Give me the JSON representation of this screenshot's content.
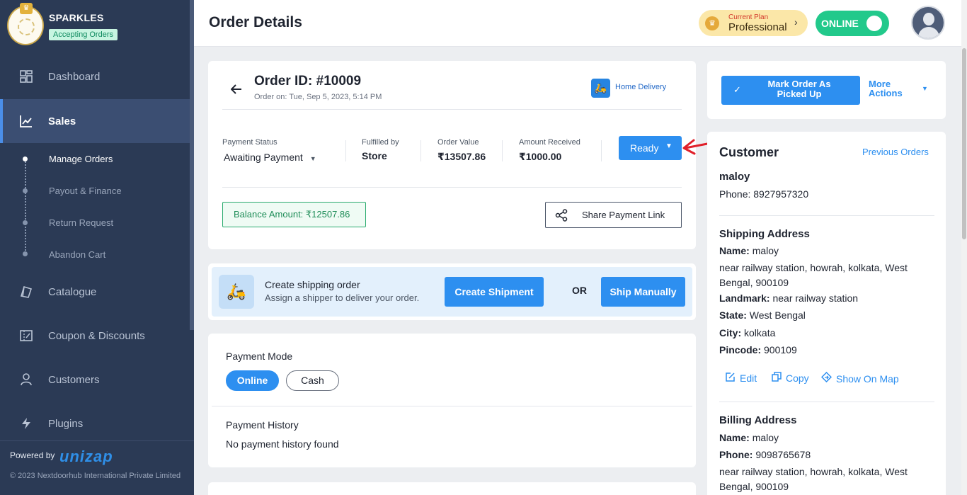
{
  "sidebar": {
    "store_name": "SPARKLES",
    "store_status": "Accepting Orders",
    "nav": [
      {
        "label": "Dashboard",
        "icon": "dashboard-icon"
      },
      {
        "label": "Sales",
        "icon": "chart-line-icon"
      },
      {
        "label": "Catalogue",
        "icon": "catalogue-icon"
      },
      {
        "label": "Coupon & Discounts",
        "icon": "coupon-icon"
      },
      {
        "label": "Customers",
        "icon": "user-icon"
      },
      {
        "label": "Plugins",
        "icon": "lightning-icon"
      }
    ],
    "sales_sub": [
      "Manage Orders",
      "Payout & Finance",
      "Return Request",
      "Abandon Cart"
    ],
    "powered_by": "Powered by",
    "powered_logo": "unizap",
    "copyright": "© 2023 Nextdoorhub International Private Limited"
  },
  "header": {
    "title": "Order Details",
    "plan_caption": "Current Plan",
    "plan_name": "Professional",
    "online_label": "ONLINE"
  },
  "order": {
    "id": "Order ID: #10009",
    "date": "Order on: Tue, Sep 5, 2023, 5:14 PM",
    "delivery_type": "Home Delivery",
    "payment_status_label": "Payment Status",
    "payment_status": "Awaiting Payment",
    "fulfilled_label": "Fulfilled by",
    "fulfilled_by": "Store",
    "value_label": "Order Value",
    "value": "₹13507.86",
    "received_label": "Amount Received",
    "received": "₹1000.00",
    "status_button": "Ready",
    "balance": "Balance Amount: ₹12507.86",
    "share_link": "Share Payment Link"
  },
  "shipping": {
    "title": "Create shipping order",
    "subtitle": "Assign a shipper to deliver your order.",
    "create_button": "Create Shipment",
    "or_text": "OR",
    "manual_button": "Ship Manually"
  },
  "payment": {
    "mode_title": "Payment Mode",
    "modes": [
      "Online",
      "Cash"
    ],
    "selected_mode": "Online",
    "history_title": "Payment History",
    "history_empty": "No payment history found"
  },
  "actions": {
    "mark_button": "Mark Order As Picked Up",
    "more_actions": "More Actions"
  },
  "customer": {
    "title": "Customer",
    "previous_orders": "Previous Orders",
    "name": "maloy",
    "phone": "Phone: 8927957320",
    "shipping": {
      "title": "Shipping Address",
      "name_label": "Name:",
      "name": "maloy",
      "address_line1": "near railway station, howrah, kolkata, West",
      "address_line2": "Bengal, 900109",
      "landmark_label": "Landmark:",
      "landmark": "near railway station",
      "state_label": "State:",
      "state": "West Bengal",
      "city_label": "City:",
      "city": "kolkata",
      "pincode_label": "Pincode:",
      "pincode": "900109"
    },
    "links": {
      "edit": "Edit",
      "copy": "Copy",
      "map": "Show On Map"
    },
    "billing": {
      "title": "Billing Address",
      "name_label": "Name:",
      "name": "maloy",
      "phone_label": "Phone:",
      "phone": "9098765678",
      "address_line1": "near railway station, howrah, kolkata, West",
      "address_line2": "Bengal, 900109"
    }
  },
  "colors": {
    "sidebar_bg": "#2b3a55",
    "primary": "#2d8ff0",
    "online": "#22c98b",
    "success": "#1f8d58",
    "annotation": "#e0202a"
  }
}
